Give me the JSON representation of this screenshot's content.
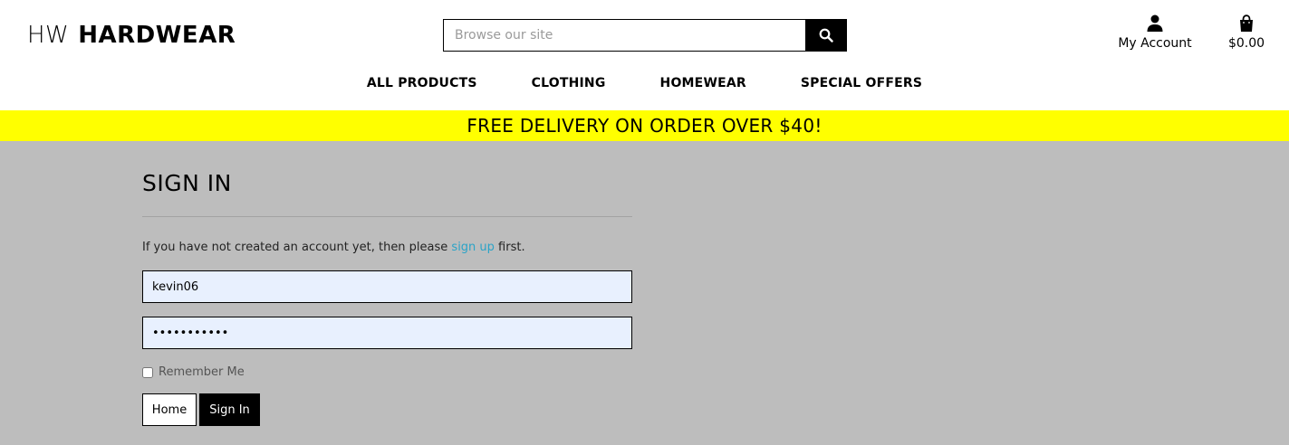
{
  "header": {
    "logo_prefix": "HW",
    "logo_name": "HARDWEAR",
    "search_placeholder": "Browse our site",
    "account_label": "My Account",
    "cart_total": "$0.00"
  },
  "nav": {
    "items": [
      {
        "label": "ALL PRODUCTS"
      },
      {
        "label": "CLOTHING"
      },
      {
        "label": "HOMEWEAR"
      },
      {
        "label": "SPECIAL OFFERS"
      }
    ]
  },
  "banner": {
    "text": "FREE DELIVERY ON ORDER OVER $40!",
    "color": "#ffff00"
  },
  "signin": {
    "title": "SIGN IN",
    "intro_before": "If you have not created an account yet, then please ",
    "signup_link": "sign up",
    "intro_after": " first.",
    "username_value": "kevin06",
    "password_value": "•••••••••••",
    "remember_label": "Remember Me",
    "home_button": "Home",
    "signin_button": "Sign In"
  },
  "colors": {
    "page_background": "#bdbdbd",
    "link": "#2aa3c7",
    "input_background": "#e8f0fe"
  },
  "icons": {
    "search": "search-icon",
    "account": "user-icon",
    "cart": "shopping-bag-icon"
  }
}
